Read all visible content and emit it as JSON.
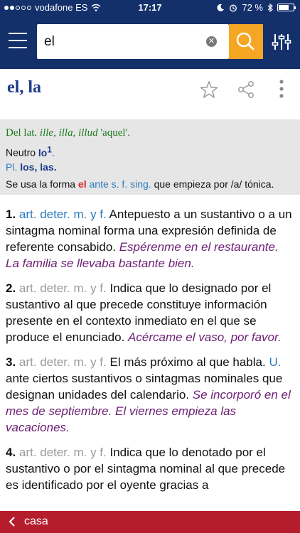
{
  "status_bar": {
    "carrier": "vodafone ES",
    "time": "17:17",
    "battery_text": "72 %",
    "battery_level": 0.72,
    "icons": [
      "signal-dots",
      "wifi-icon",
      "moon-icon",
      "alarm-icon",
      "bluetooth-icon",
      "battery-icon"
    ]
  },
  "search": {
    "value": "el",
    "icons": [
      "menu-icon",
      "clear-icon",
      "search-icon",
      "filter-sliders-icon"
    ]
  },
  "entry": {
    "headword": "el, la",
    "actions": [
      "star-icon",
      "share-icon",
      "more-vertical-icon"
    ]
  },
  "etymology": {
    "prefix": "Del lat. ",
    "latin": "ille, illa, illud",
    "meaning": " 'aquel'.",
    "neutral_label": "Neutro ",
    "neutral_word": "lo",
    "neutral_sup": "1",
    "plural_abbr": "Pl.",
    "plural_words": " los, las.",
    "usage_pre": "Se usa la forma ",
    "usage_form": "el",
    "usage_abbr": " ante s. f. sing.",
    "usage_post": " que empieza por /a/ tónica."
  },
  "definitions": [
    {
      "num": "1.",
      "gram": "art. deter. m. y f.",
      "text": "Antepuesto a un sustantivo o a un sintagma nominal forma una expresión definida de referente consabido. ",
      "example": "Espérenme en el restaurante. La familia se llevaba bastante bien."
    },
    {
      "num": "2.",
      "gram": "art. deter. m. y f.",
      "text": "Indica que lo designado por el sustantivo al que precede constituye información presente en el contexto inmediato en el que se produce el enunciado. ",
      "example": "Acércame el vaso, por favor."
    },
    {
      "num": "3.",
      "gram": "art. deter. m. y f.",
      "text": "El más próximo al que habla. ",
      "extra_abbr": "U.",
      "text2": " ante ciertos sustantivos o sintagmas nominales que designan unidades del calendario. ",
      "example": "Se incorporó en el mes de septiembre. El viernes empieza las vacaciones."
    },
    {
      "num": "4.",
      "gram": "art. deter. m. y f.",
      "text": "Indica que lo denotado por el sustantivo o por el sintagma nominal al que precede es identificado por el oyente gracias a",
      "example": ""
    }
  ],
  "bottom_bar": {
    "label": "casa"
  }
}
